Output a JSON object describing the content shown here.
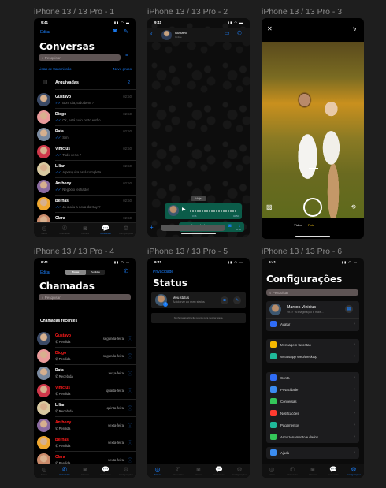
{
  "frames": [
    {
      "label": "iPhone 13 / 13 Pro - 1"
    },
    {
      "label": "iPhone 13 / 13 Pro - 2"
    },
    {
      "label": "iPhone 13 / 13 Pro - 3"
    },
    {
      "label": "iPhone 13 / 13 Pro - 4"
    },
    {
      "label": "iPhone 13 / 13 Pro - 5"
    },
    {
      "label": "iPhone 13 / 13 Pro - 6"
    }
  ],
  "status_time": "9:41",
  "accent": "#1a7cf5",
  "tabs": [
    "Status",
    "Chamadas",
    "Câmera",
    "Conversas",
    "Configurações"
  ],
  "tab_icons": [
    "status-icon",
    "phone-icon",
    "camera-icon",
    "chats-icon",
    "settings-icon"
  ],
  "chats": {
    "edit": "Editar",
    "title": "Conversas",
    "search_placeholder": "Pesquisar",
    "broadcast": "Listas de transmissão",
    "new_group": "Novo grupo",
    "archived": "Arquivadas",
    "archived_count": "2",
    "items": [
      {
        "name": "Gustavo",
        "message": "Bom dia, tudo bem ?",
        "time": "02:50"
      },
      {
        "name": "Diogo",
        "message": "Ok, está tudo certo então",
        "time": "02:50"
      },
      {
        "name": "Rafa",
        "message": "Sim",
        "time": "02:50"
      },
      {
        "name": "Vinicius",
        "message": "Tudo certo ?",
        "time": "02:50"
      },
      {
        "name": "Lilian",
        "message": "A pesquisa está completa",
        "time": "02:50"
      },
      {
        "name": "Anthony",
        "message": "Negócio fechado!",
        "time": "02:50"
      },
      {
        "name": "Bernas",
        "message": "Já ouviu a nova do Kay ?",
        "time": "02:50"
      },
      {
        "name": "Clara",
        "message": "Você tá bem ?",
        "time": "02:50"
      }
    ]
  },
  "conversation": {
    "contact": "Gustavo",
    "presence": "Online",
    "day": "Hoje",
    "voice_duration": "0:06",
    "voice_time": "02:50",
    "text": "Bom dia, tudo bem ?",
    "text_time": "02:50"
  },
  "camera": {
    "modes": [
      "Vídeo",
      "Foto"
    ],
    "active_mode": "Foto",
    "active_color": "#f0c419"
  },
  "calls": {
    "edit": "Editar",
    "segments": [
      "Todas",
      "Perdidas"
    ],
    "title": "Chamadas",
    "search_placeholder": "Pesquisar",
    "section": "Chamadas recentes",
    "missed_color": "#ff1a1a",
    "items": [
      {
        "name": "Gustavo",
        "type": "Perdida",
        "day": "segunda-feira",
        "missed": true
      },
      {
        "name": "Diogo",
        "type": "Perdida",
        "day": "segunda-feira",
        "missed": true
      },
      {
        "name": "Rafa",
        "type": "Recebida",
        "day": "terça-feira",
        "missed": false
      },
      {
        "name": "Vinicius",
        "type": "Perdida",
        "day": "quarta-feira",
        "missed": true
      },
      {
        "name": "Lilian",
        "type": "Recebida",
        "day": "quinta-feira",
        "missed": false
      },
      {
        "name": "Anthony",
        "type": "Perdida",
        "day": "sexta-feira",
        "missed": true
      },
      {
        "name": "Bernas",
        "type": "Perdida",
        "day": "sexta-feira",
        "missed": true
      },
      {
        "name": "Clara",
        "type": "Perdida",
        "day": "sexta-feira",
        "missed": true
      }
    ]
  },
  "status": {
    "privacy": "Privacidade",
    "title": "Status",
    "my_status": "Meu status",
    "add_hint": "Adicionar ao meu status",
    "empty": "Nenhuma atualização recente para mostrar agora."
  },
  "settings": {
    "title": "Configurações",
    "search_placeholder": "Pesquisar",
    "profile_name": "Marcos Vinicius",
    "profile_about": "<h1> \"A imaginação é mais...",
    "avatar_row": "Avatar",
    "group1": [
      {
        "label": "Mensagem favoritas",
        "color": "#f5b800"
      },
      {
        "label": "WhatsApp Web/Desktop",
        "color": "#1fb99a"
      }
    ],
    "group2": [
      {
        "label": "Conta",
        "color": "#2f6cf6"
      },
      {
        "label": "Privacidade",
        "color": "#3b8cf0"
      },
      {
        "label": "Conversas",
        "color": "#34c759"
      },
      {
        "label": "Notificações",
        "color": "#ff3b30"
      },
      {
        "label": "Pagamentos",
        "color": "#1fb99a"
      },
      {
        "label": "Armazenamento e dados",
        "color": "#34c759"
      }
    ],
    "group3": [
      {
        "label": "Ajuda",
        "color": "#3b8cf0"
      }
    ]
  }
}
